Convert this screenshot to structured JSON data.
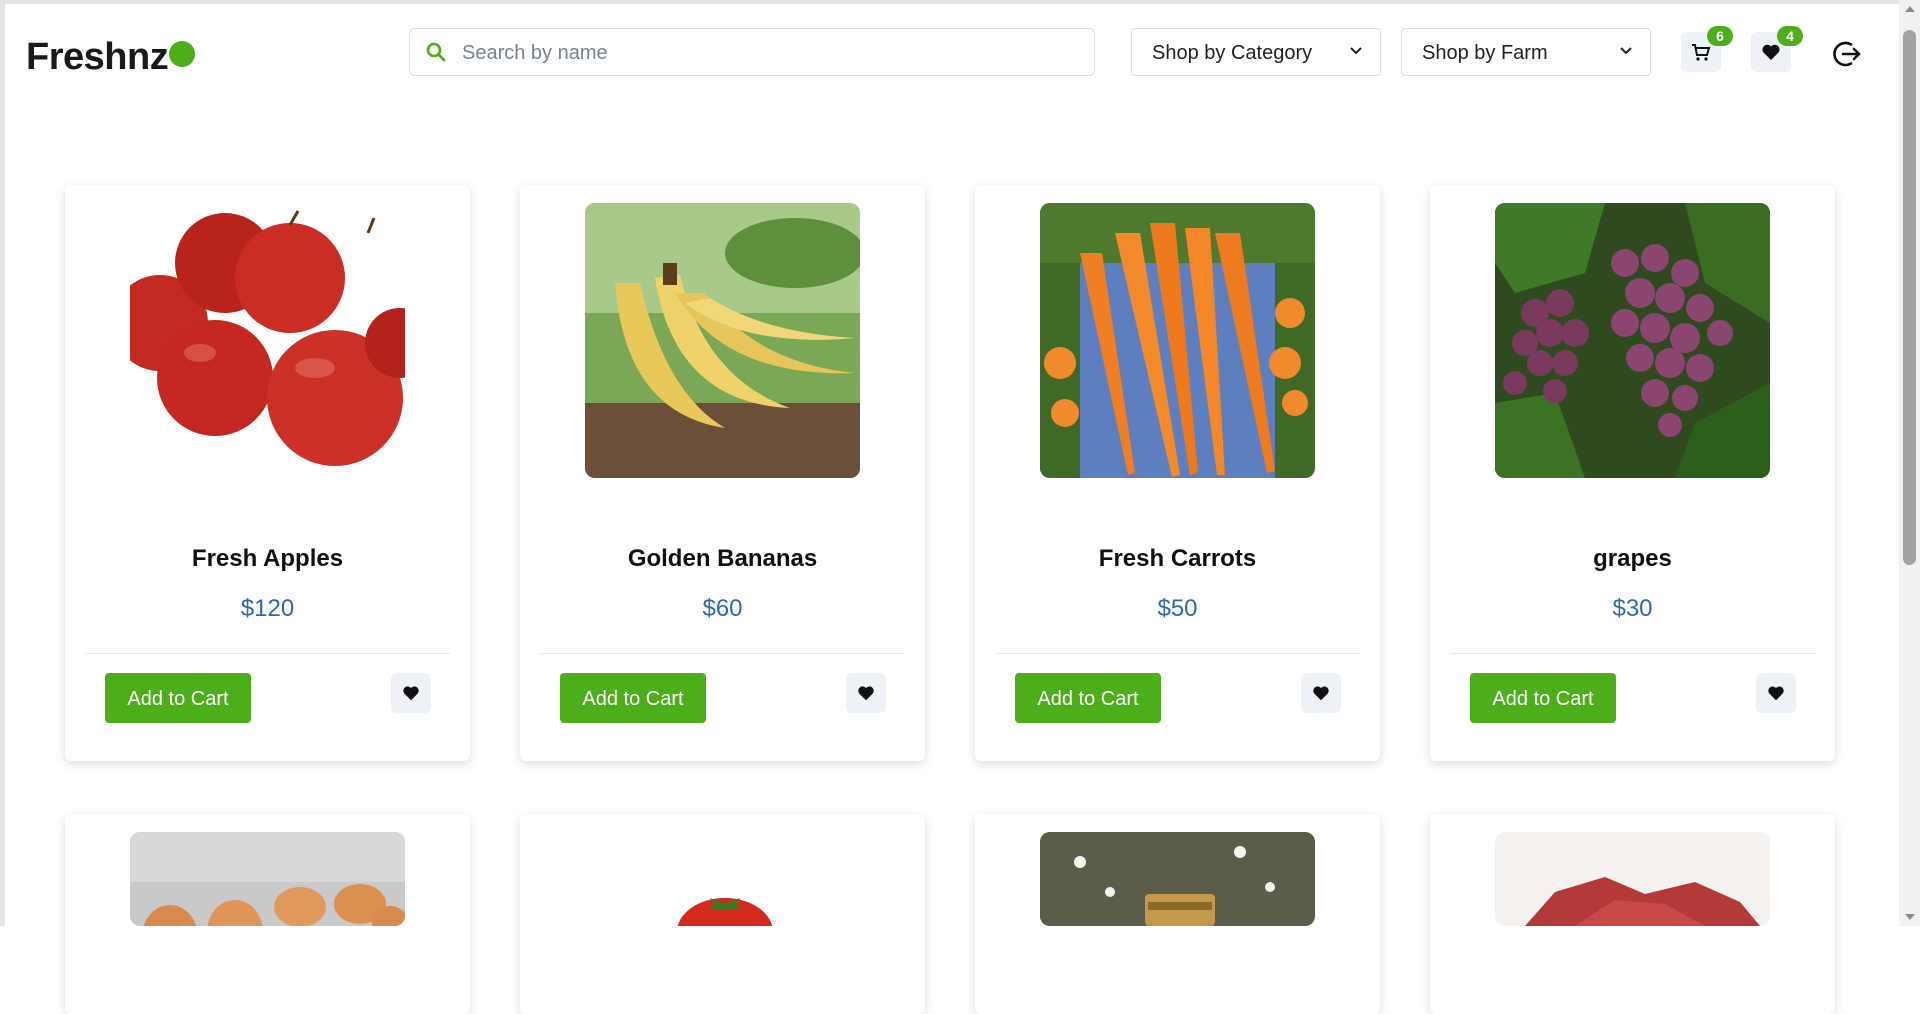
{
  "header": {
    "logo": "Freshnz",
    "search_placeholder": "Search by name",
    "category_select": "Shop by Category",
    "farm_select": "Shop by Farm",
    "cart_count": "6",
    "wishlist_count": "4"
  },
  "products": [
    {
      "name": "Fresh Apples",
      "price": "$120",
      "add_label": "Add to Cart",
      "image": "apples"
    },
    {
      "name": "Golden Bananas",
      "price": "$60",
      "add_label": "Add to Cart",
      "image": "bananas"
    },
    {
      "name": "Fresh Carrots",
      "price": "$50",
      "add_label": "Add to Cart",
      "image": "carrots"
    },
    {
      "name": "grapes",
      "price": "$30",
      "add_label": "Add to Cart",
      "image": "grapes"
    }
  ],
  "next_row_images": [
    "eggs",
    "tomato",
    "jar-of-honey",
    "red-meat"
  ],
  "colors": {
    "accent": "#4caf1a",
    "price": "#2b6cb0",
    "chip": "#eef1f5"
  }
}
